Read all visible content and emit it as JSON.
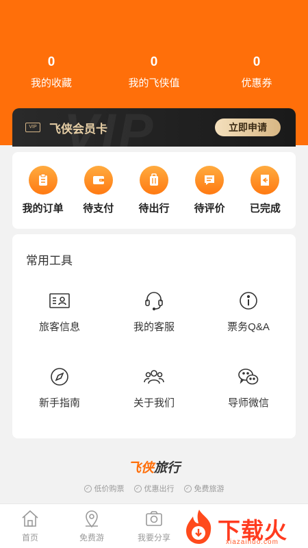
{
  "stats": [
    {
      "value": "0",
      "label": "我的收藏"
    },
    {
      "value": "0",
      "label": "我的飞侠值"
    },
    {
      "value": "0",
      "label": "优惠券"
    }
  ],
  "vip": {
    "badge": "VIP",
    "title": "飞侠会员卡",
    "apply_label": "立即申请",
    "watermark": "VIP"
  },
  "orders": [
    {
      "label": "我的订单",
      "icon": "clipboard-icon"
    },
    {
      "label": "待支付",
      "icon": "wallet-icon"
    },
    {
      "label": "待出行",
      "icon": "luggage-icon"
    },
    {
      "label": "待评价",
      "icon": "comment-icon"
    },
    {
      "label": "已完成",
      "icon": "done-icon"
    }
  ],
  "tools": {
    "title": "常用工具",
    "items": [
      {
        "label": "旅客信息",
        "icon": "id-card-icon"
      },
      {
        "label": "我的客服",
        "icon": "headset-icon"
      },
      {
        "label": "票务Q&A",
        "icon": "info-icon"
      },
      {
        "label": "新手指南",
        "icon": "compass-icon"
      },
      {
        "label": "关于我们",
        "icon": "team-icon"
      },
      {
        "label": "导师微信",
        "icon": "wechat-icon"
      }
    ]
  },
  "brand": {
    "name_a": "飞侠",
    "name_b": "旅行",
    "tags": [
      "低价购票",
      "优惠出行",
      "免费旅游"
    ]
  },
  "tabbar": [
    {
      "label": "首页",
      "icon": "home-icon"
    },
    {
      "label": "免费游",
      "icon": "location-pin-icon"
    },
    {
      "label": "我要分享",
      "icon": "camera-icon"
    }
  ],
  "watermark": {
    "text": "下载火",
    "url": "xiazaihuo.com"
  },
  "colors": {
    "accent": "#ff6f0a",
    "vip_gold": "#e7cfa6",
    "background": "#f2f2f2"
  }
}
